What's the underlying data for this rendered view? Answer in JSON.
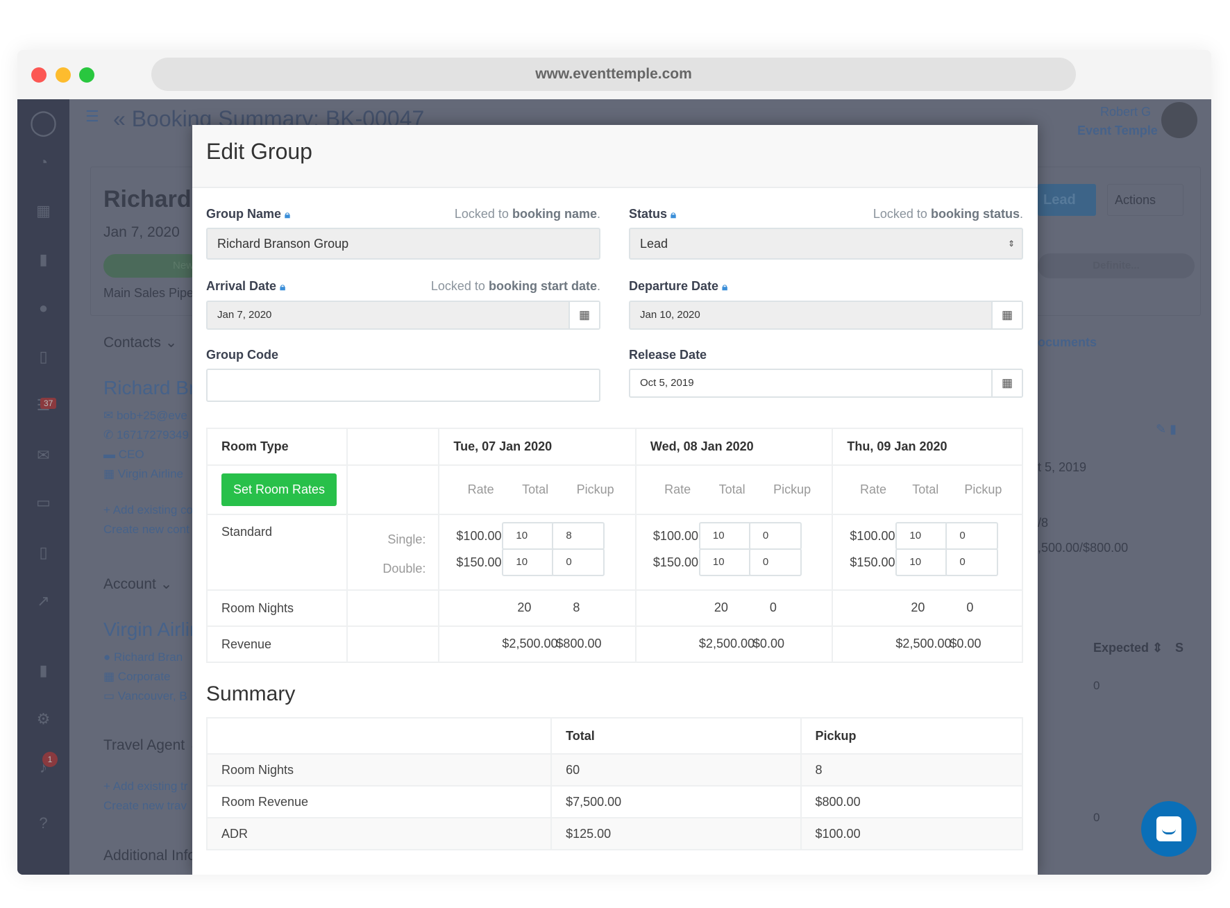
{
  "browser": {
    "url": "www.eventtemple.com"
  },
  "background": {
    "page_title": "Booking Summary: BK-00047",
    "user_name": "Robert G",
    "org": "Event Temple",
    "booking_name": "Richard B",
    "date": "Jan 7, 2020",
    "stage": "New",
    "pipeline": "Main Sales Pipel",
    "status_btn": "Lead",
    "actions_btn": "Actions",
    "definite": "Definite...",
    "contacts": "Contacts",
    "contact_name": "Richard Br",
    "email": "bob+25@eve",
    "phone": "16717279349",
    "title": "CEO",
    "company": "Virgin Airline",
    "add_contact": "+ Add existing co",
    "create_contact": "Create new cont",
    "account": "Account",
    "account_name": "Virgin Airlir",
    "acc_contact": "Richard Bran",
    "acc_type": "Corporate",
    "acc_loc": "Vancouver, B",
    "travel_agent": "Travel Agent",
    "add_ta": "+ Add existing tr",
    "create_ta": "Create new trav",
    "additional": "Additional Info",
    "documents": "ocuments",
    "release": "t 5, 2019",
    "nights": "/8",
    "revenue": ",500.00/$800.00",
    "expected": "Expected",
    "sp": "S",
    "zero": "0",
    "badge_tasks": "37",
    "badge_notif": "1"
  },
  "modal": {
    "title": "Edit Group",
    "group_name": {
      "label": "Group Name",
      "hint_pre": "Locked to",
      "hint_bold": "booking name",
      "value": "Richard Branson Group"
    },
    "status": {
      "label": "Status",
      "hint_pre": "Locked to",
      "hint_bold": "booking status",
      "value": "Lead"
    },
    "arrival": {
      "label": "Arrival Date",
      "hint_pre": "Locked to",
      "hint_bold": "booking start date",
      "value": "Jan 7, 2020"
    },
    "departure": {
      "label": "Departure Date",
      "value": "Jan 10, 2020"
    },
    "group_code": {
      "label": "Group Code",
      "value": ""
    },
    "release": {
      "label": "Release Date",
      "value": "Oct 5, 2019"
    },
    "grid": {
      "room_type_header": "Room Type",
      "set_rates": "Set Room Rates",
      "sub": {
        "rate": "Rate",
        "total": "Total",
        "pickup": "Pickup"
      },
      "room": "Standard",
      "single": "Single:",
      "double": "Double:",
      "room_nights": "Room Nights",
      "revenue": "Revenue",
      "days": [
        {
          "date": "Tue, 07 Jan 2020",
          "single_rate": "$100.00",
          "single_total": "10",
          "single_pickup": "8",
          "double_rate": "$150.00",
          "double_total": "10",
          "double_pickup": "0",
          "nights_total": "20",
          "nights_pickup": "8",
          "rev_total": "$2,500.00",
          "rev_pickup": "$800.00"
        },
        {
          "date": "Wed, 08 Jan 2020",
          "single_rate": "$100.00",
          "single_total": "10",
          "single_pickup": "0",
          "double_rate": "$150.00",
          "double_total": "10",
          "double_pickup": "0",
          "nights_total": "20",
          "nights_pickup": "0",
          "rev_total": "$2,500.00",
          "rev_pickup": "$0.00"
        },
        {
          "date": "Thu, 09 Jan 2020",
          "single_rate": "$100.00",
          "single_total": "10",
          "single_pickup": "0",
          "double_rate": "$150.00",
          "double_total": "10",
          "double_pickup": "0",
          "nights_total": "20",
          "nights_pickup": "0",
          "rev_total": "$2,500.00",
          "rev_pickup": "$0.00"
        }
      ]
    },
    "summary": {
      "title": "Summary",
      "col_total": "Total",
      "col_pickup": "Pickup",
      "rows": [
        {
          "label": "Room Nights",
          "total": "60",
          "pickup": "8"
        },
        {
          "label": "Room Revenue",
          "total": "$7,500.00",
          "pickup": "$800.00"
        },
        {
          "label": "ADR",
          "total": "$125.00",
          "pickup": "$100.00"
        }
      ]
    }
  }
}
